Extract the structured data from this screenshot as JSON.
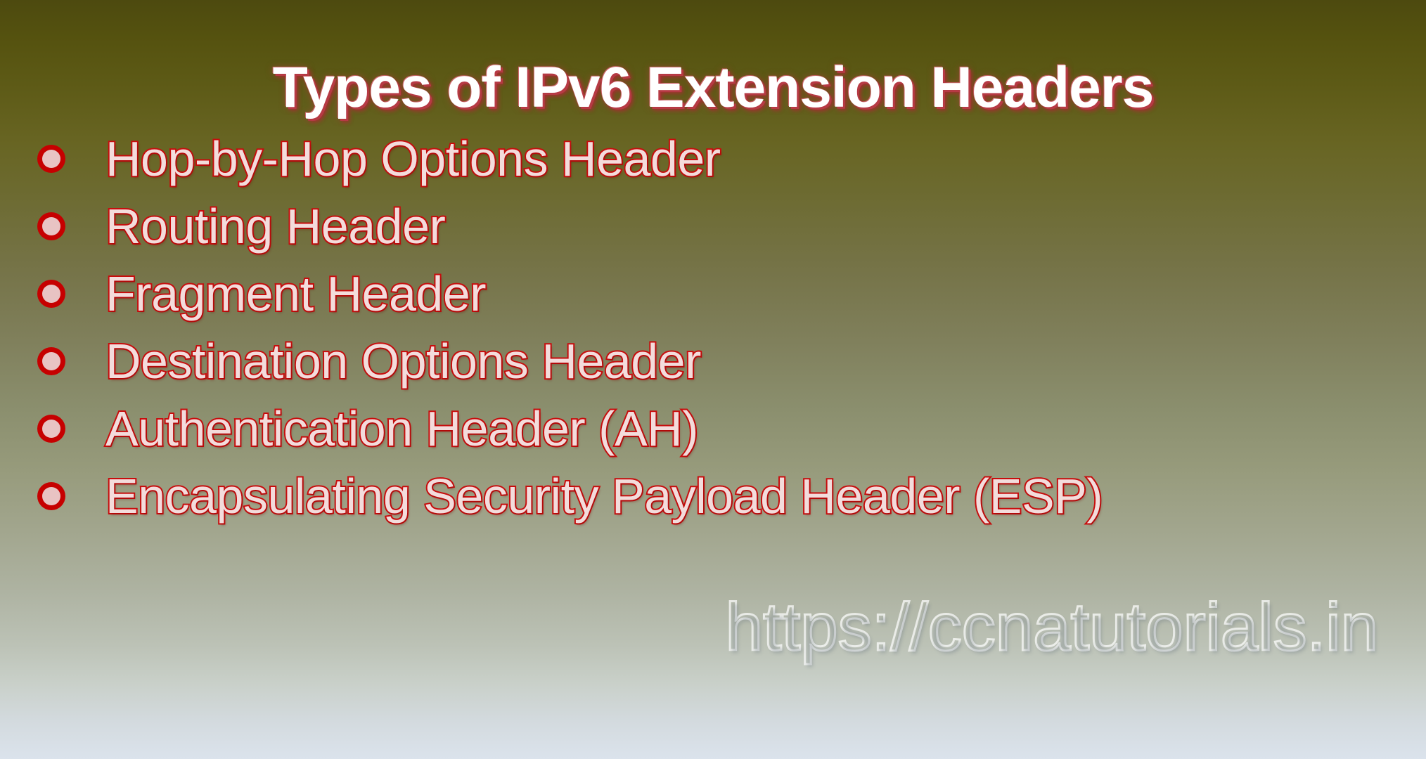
{
  "slide": {
    "title": "Types of IPv6 Extension Headers",
    "watermark": "https://ccnatutorials.in",
    "bullet_marker_icon": "bullet-circle-icon",
    "items": [
      {
        "label": "Hop-by-Hop Options Header"
      },
      {
        "label": "Routing Header"
      },
      {
        "label": "Fragment Header"
      },
      {
        "label": "Destination Options Header"
      },
      {
        "label": "Authentication Header (AH)"
      },
      {
        "label": "Encapsulating Security Payload Header (ESP)"
      }
    ],
    "colors": {
      "background_top": "#4d4a0f",
      "background_mid": "#93997c",
      "background_bottom": "#dbe3ec",
      "title_fill": "#ffffff",
      "title_shadow": "#b63a44",
      "bullet_text_stroke": "#c80d0d",
      "bullet_text_fill": "#f3dcdc",
      "bullet_marker_fill": "#e8c3c3",
      "bullet_marker_ring": "#c60000",
      "watermark_stroke": "#ffffff"
    }
  }
}
